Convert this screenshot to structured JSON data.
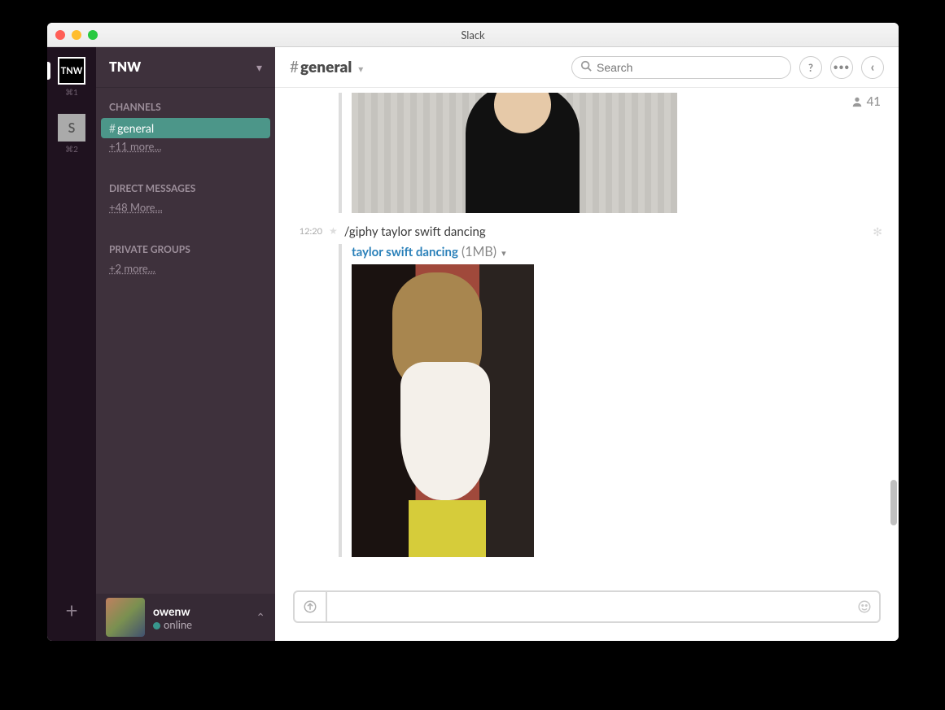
{
  "window": {
    "title": "Slack"
  },
  "rail": {
    "ws1_label": "TNW",
    "ws1_shortcut": "⌘1",
    "ws2_label": "S",
    "ws2_shortcut": "⌘2",
    "plus": "+"
  },
  "sidebar": {
    "workspace_name": "TNW",
    "sections": {
      "channels_label": "CHANNELS",
      "channels": [
        {
          "name": "general",
          "active": true
        }
      ],
      "channels_more": "+11 more...",
      "dm_label": "DIRECT MESSAGES",
      "dm_more": "+48 More...",
      "pg_label": "PRIVATE GROUPS",
      "pg_more": "+2 more..."
    },
    "user": {
      "name": "owenw",
      "status": "online"
    }
  },
  "header": {
    "channel_prefix": "#",
    "channel_name": "general",
    "search_placeholder": "Search",
    "help": "?",
    "more": "•••",
    "collapse": "‹",
    "member_count": "41"
  },
  "messages": [
    {
      "time": "12:20",
      "text": "/giphy taylor swift dancing",
      "attachment": {
        "title": "taylor swift dancing",
        "size": "(1MB)"
      }
    }
  ],
  "composer": {
    "placeholder": ""
  }
}
